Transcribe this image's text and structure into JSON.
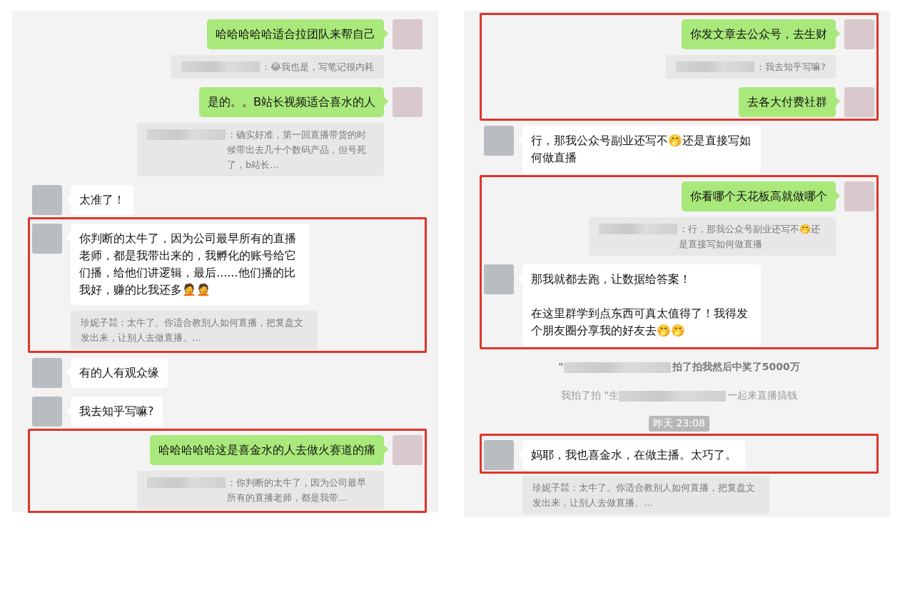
{
  "panels": [
    {
      "items": [
        {
          "kind": "sent",
          "text": "哈哈哈哈哈适合拉团队来帮自己"
        },
        {
          "kind": "sent_quote",
          "sender_hidden": true,
          "text": "：😂我也是，写笔记很内耗"
        },
        {
          "kind": "sent",
          "text": "是的。。B站长视频适合喜水的人"
        },
        {
          "kind": "sent_quote",
          "sender_hidden": true,
          "text": "：确实好准，第一回直播带货的时候带出去几十个数码产品，但号死了，b站长..."
        },
        {
          "kind": "received",
          "text": "太准了！"
        },
        {
          "kind": "highlight",
          "items": [
            {
              "kind": "received",
              "text": "你判断的太牛了，因为公司最早所有的直播老师，都是我带出来的，我孵化的账号给它们播，给他们讲逻辑，最后......他们播的比我好，赚的比我还多🤦🤦"
            },
            {
              "kind": "received_quote",
              "sender_hidden": false,
              "text": "珍妮子㍿：太牛了。你适合教别人如何直播，把复盘文发出来，让别人去做直播。..."
            }
          ]
        },
        {
          "kind": "received",
          "text": "有的人有观众缘"
        },
        {
          "kind": "received",
          "text": "我去知乎写嘛?"
        },
        {
          "kind": "highlight",
          "items": [
            {
              "kind": "sent",
              "text": "哈哈哈哈哈这是喜金水的人去做火赛道的痛"
            },
            {
              "kind": "sent_quote",
              "sender_hidden": true,
              "text": "：你判断的太牛了，因为公司最早所有的直播老师，都是我带..."
            }
          ]
        }
      ]
    },
    {
      "items": [
        {
          "kind": "highlight",
          "items": [
            {
              "kind": "sent",
              "text": "你发文章去公众号，去生财"
            },
            {
              "kind": "sent_quote",
              "sender_hidden": true,
              "text": "：我去知乎写嘛?"
            },
            {
              "kind": "sent",
              "text": "去各大付费社群"
            }
          ]
        },
        {
          "kind": "received",
          "text": "行，那我公众号副业还写不🤭还是直接写如何做直播"
        },
        {
          "kind": "highlight",
          "items": [
            {
              "kind": "sent",
              "text": "你看哪个天花板高就做哪个"
            },
            {
              "kind": "sent_quote",
              "sender_hidden": true,
              "text": "：行，那我公众号副业还写不🤭还是直接写如何做直播"
            },
            {
              "kind": "received",
              "paragraphs": [
                "那我就都去跑，让数据给答案！",
                "在这里群学到点东西可真太值得了！我得发个朋友圈分享我的好友去🤭🤭"
              ]
            }
          ]
        },
        {
          "kind": "system",
          "emphasis": true,
          "before": "\"",
          "after": "拍了拍我然后中奖了5000万"
        },
        {
          "kind": "system",
          "emphasis": false,
          "before": "我拍了拍 \"生",
          "after": "一起来直播搞钱"
        },
        {
          "kind": "time",
          "text": "昨天 23:08"
        },
        {
          "kind": "highlight",
          "items": [
            {
              "kind": "received",
              "text": "妈耶，我也喜金水，在做主播。太巧了。"
            }
          ]
        },
        {
          "kind": "received_quote",
          "sender_hidden": false,
          "text": "珍妮子㍿：太牛了。你适合教别人如何直播，把复盘文发出来，让别人去做直播。..."
        }
      ]
    }
  ]
}
